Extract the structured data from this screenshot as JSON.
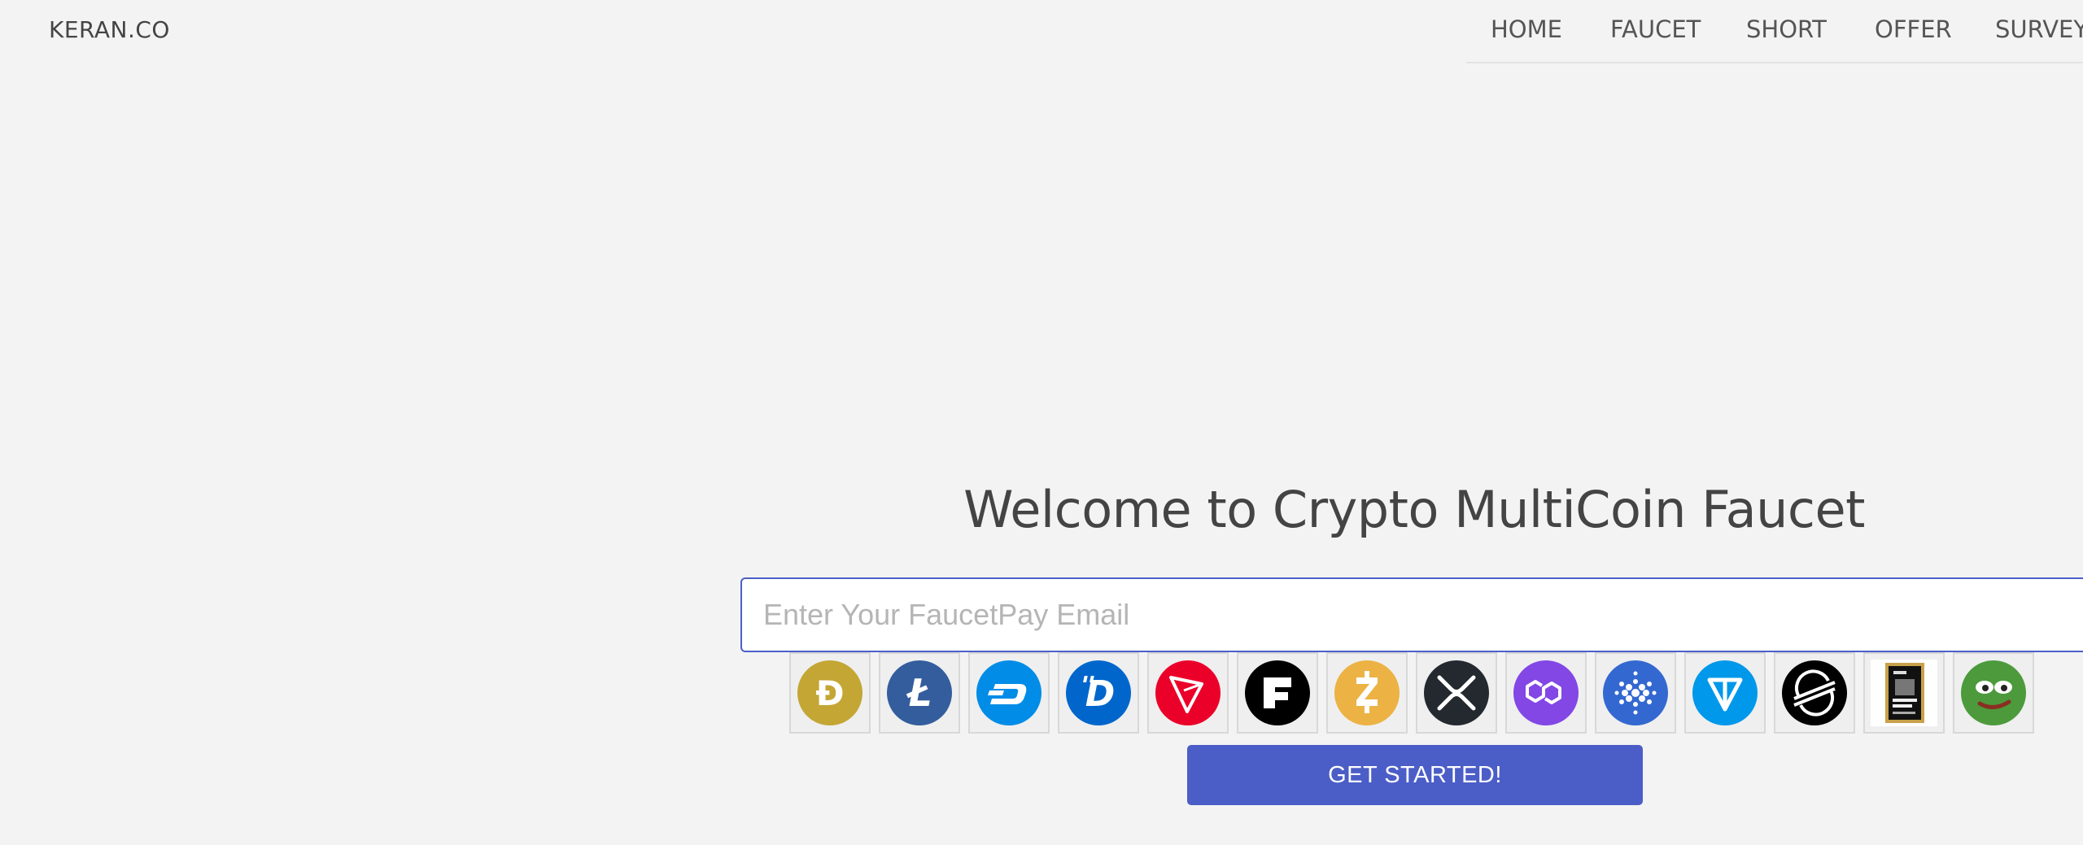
{
  "brand": "KERAN.CO",
  "nav": {
    "items": [
      {
        "label": "HOME"
      },
      {
        "label": "FAUCET"
      },
      {
        "label": "SHORT"
      },
      {
        "label": "OFFER"
      },
      {
        "label": "SURVEY"
      }
    ]
  },
  "hero": {
    "title": "Welcome to Crypto MultiCoin Faucet"
  },
  "email": {
    "placeholder": "Enter Your FaucetPay Email",
    "value": ""
  },
  "coins": [
    {
      "icon": "dogecoin-icon",
      "color": "#c3a634",
      "glyph": "Ð"
    },
    {
      "icon": "litecoin-icon",
      "color": "#345d9d",
      "glyph": "Ł"
    },
    {
      "icon": "dash-icon",
      "color": "#008ce7",
      "glyph": "D"
    },
    {
      "icon": "digibyte-icon",
      "color": "#0066cc",
      "glyph": "Ɖ"
    },
    {
      "icon": "tron-icon",
      "color": "#eb0029",
      "glyph": "▽"
    },
    {
      "icon": "feyorra-icon",
      "color": "#000000",
      "glyph": "F"
    },
    {
      "icon": "zcash-icon",
      "color": "#ecb244",
      "glyph": "Ƶ"
    },
    {
      "icon": "xrp-icon",
      "color": "#23292f",
      "glyph": "✕"
    },
    {
      "icon": "polygon-icon",
      "color": "#8247e5",
      "glyph": "∞"
    },
    {
      "icon": "cardano-icon",
      "color": "#3468d1",
      "glyph": "✺"
    },
    {
      "icon": "toncoin-icon",
      "color": "#0098ea",
      "glyph": "▽"
    },
    {
      "icon": "stellar-icon",
      "color": "#000000",
      "glyph": "≈"
    },
    {
      "icon": "fight-token-icon",
      "color": "#1a1a1a",
      "glyph": ""
    },
    {
      "icon": "pepe-icon",
      "color": "#4c9a3c",
      "glyph": ""
    }
  ],
  "cta": {
    "label": "GET STARTED!"
  }
}
